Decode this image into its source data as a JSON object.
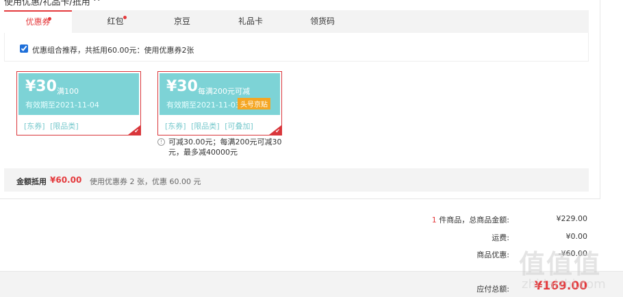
{
  "section": {
    "title": "使用优惠/礼品卡/抵用 ^"
  },
  "tabs": [
    {
      "label": "优惠券",
      "active": true,
      "dot": true
    },
    {
      "label": "红包",
      "active": false,
      "dot": true
    },
    {
      "label": "京豆",
      "active": false,
      "dot": false
    },
    {
      "label": "礼品卡",
      "active": false,
      "dot": false
    },
    {
      "label": "领货码",
      "active": false,
      "dot": false
    }
  ],
  "recommend": {
    "checked": true,
    "text": "优惠组合推荐，共抵用60.00元：使用优惠券2张"
  },
  "coupons": [
    {
      "amount": "¥30",
      "condition": "满100",
      "expire": "有效期至2021-11-04",
      "badge": "",
      "tags": [
        "[东券]",
        "[限品类]"
      ]
    },
    {
      "amount": "¥30",
      "condition": "每满200元可减",
      "expire": "有效期至2021-11-03",
      "badge": "头号京贴",
      "tags": [
        "[东券]",
        "[限品类]",
        "[可叠加]"
      ]
    }
  ],
  "coupon_note": {
    "line1": "可减30.00元；每满200元可减30",
    "line2": "元，最多减40000元"
  },
  "summary": {
    "label": "金额抵用",
    "amount": "¥60.00",
    "desc": "使用优惠券 2 张，优惠 60.00 元"
  },
  "totals": {
    "items": {
      "qty": "1",
      "label": " 件商品，总商品金额:",
      "value": "¥229.00"
    },
    "shipping": {
      "label": "运费:",
      "value": "¥0.00"
    },
    "discount": {
      "label": "商品优惠:",
      "value": "-¥60.00"
    }
  },
  "payable": {
    "label": "应付总额:",
    "value": "¥169.00"
  },
  "watermark": {
    "big": "值值值",
    "small": "zhi.laizhi.com"
  },
  "colors": {
    "accent": "#e4393c",
    "coupon_bg": "#7dd3d6",
    "badge": "#f5a623"
  }
}
